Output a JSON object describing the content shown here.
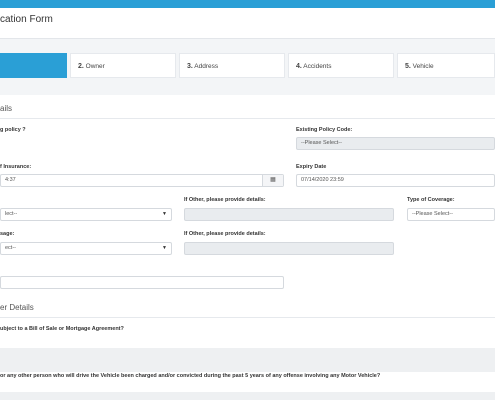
{
  "header": {
    "title": "cation Form"
  },
  "steps": [
    {
      "number": "",
      "label": ""
    },
    {
      "number": "2.",
      "label": "Owner"
    },
    {
      "number": "3.",
      "label": "Address"
    },
    {
      "number": "4.",
      "label": "Accidents"
    },
    {
      "number": "5.",
      "label": "Vehicle"
    }
  ],
  "colors": {
    "accent": "#2a9fd6"
  },
  "policy": {
    "section_title": "ails",
    "q_policy": "g policy ?",
    "existing_code_label": "Existing Policy Code:",
    "existing_code_value": "--Please Select--",
    "insurance_label": "f Insurance:",
    "insurance_value": "4:37",
    "calendar_icon": "calendar-icon",
    "expiry_label": "Expiry Date",
    "expiry_value": "07/14/2020 23:59",
    "select1_value": "lect--",
    "other1_label": "If Other, please provide details:",
    "coverage_label": "Type of Coverage:",
    "coverage_value": "--Please Select--",
    "usage_label": "sage:",
    "select2_value": "ect--",
    "other2_label": "If Other, please provide details:"
  },
  "owner": {
    "section_title": "er Details",
    "q1": "ubject to a Bill of Sale or Mortgage Agreement?",
    "q2": "or any other person who will drive the Vehicle been charged and/or convicted during the past 5 years of any offense involving any Motor Vehicle?"
  }
}
